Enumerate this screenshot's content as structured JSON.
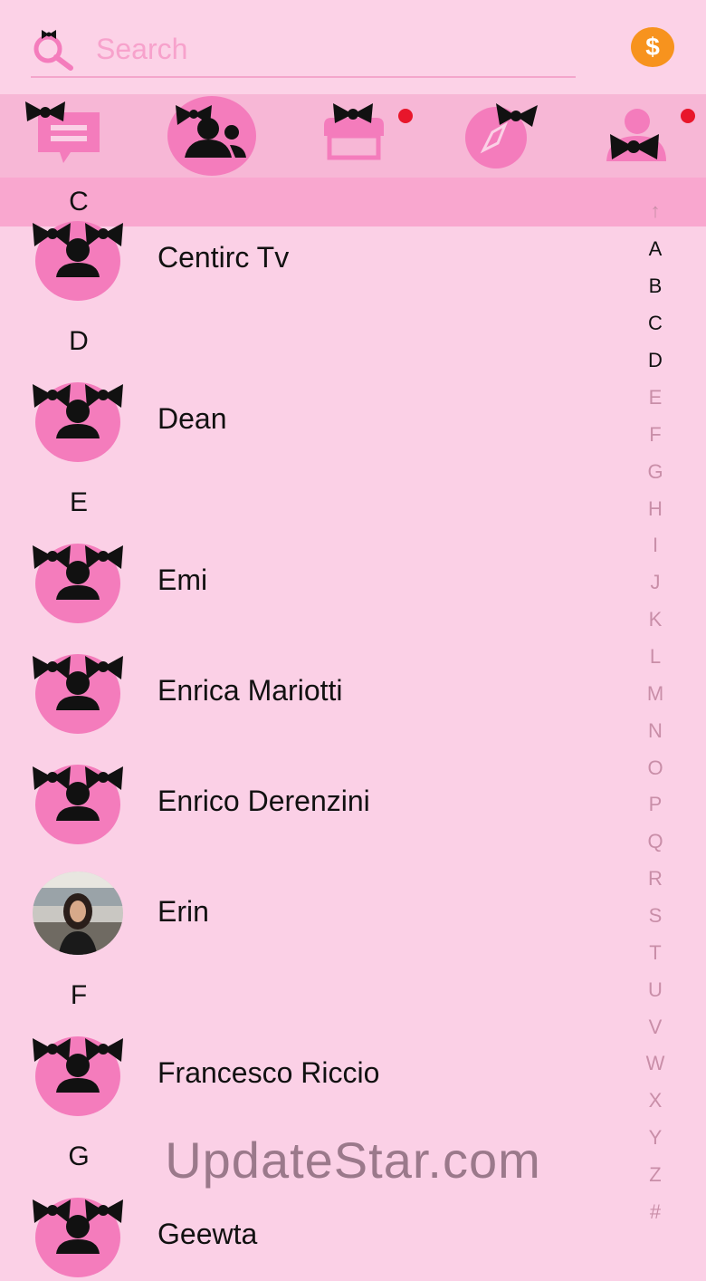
{
  "search": {
    "placeholder": "Search"
  },
  "coin_symbol": "$",
  "tabs": [
    {
      "name": "chats",
      "icon": "chat-bubble-icon",
      "badge": false
    },
    {
      "name": "contacts",
      "icon": "people-icon",
      "badge": false,
      "active": true
    },
    {
      "name": "store",
      "icon": "shop-icon",
      "badge": true
    },
    {
      "name": "discover",
      "icon": "compass-icon",
      "badge": false
    },
    {
      "name": "me",
      "icon": "profile-icon",
      "badge": true
    }
  ],
  "sticky_section": "C",
  "sections": [
    {
      "letter": "C",
      "contacts": [
        "Centirc Tv"
      ]
    },
    {
      "letter": "D",
      "contacts": [
        "Dean"
      ]
    },
    {
      "letter": "E",
      "contacts": [
        "Emi",
        "Enrica Mariotti",
        "Enrico Derenzini",
        "Erin"
      ]
    },
    {
      "letter": "F",
      "contacts": [
        "Francesco Riccio"
      ]
    },
    {
      "letter": "G",
      "contacts": [
        "Geewta"
      ]
    }
  ],
  "index": [
    "↑",
    "A",
    "B",
    "C",
    "D",
    "E",
    "F",
    "G",
    "H",
    "I",
    "J",
    "K",
    "L",
    "M",
    "N",
    "O",
    "P",
    "Q",
    "R",
    "S",
    "T",
    "U",
    "V",
    "W",
    "X",
    "Y",
    "Z",
    "#"
  ],
  "watermark": "UpdateStar.com",
  "colors": {
    "background": "#fbd0e6",
    "tabbar": "#f7b7d6",
    "accent_pink": "#f47cbc",
    "coin": "#f7931e",
    "badge_red": "#e8162b"
  }
}
